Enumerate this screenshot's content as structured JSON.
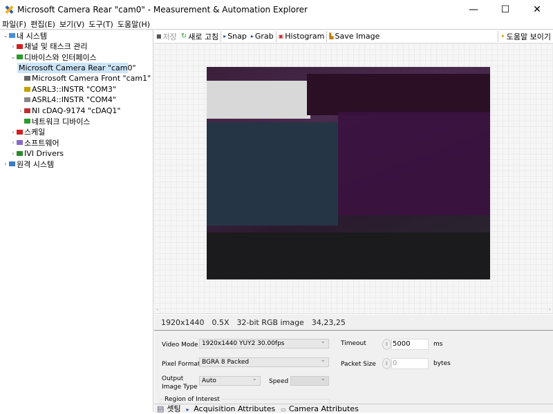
{
  "window": {
    "title": "Microsoft Camera Rear  \"cam0\" - Measurement & Automation Explorer",
    "minimize": "—",
    "maximize": "☐",
    "close": "✕"
  },
  "menu": [
    "파일(F)",
    "편집(E)",
    "보기(V)",
    "도구(T)",
    "도움말(H)"
  ],
  "tree": [
    {
      "label": "내 시스템",
      "level": 0,
      "arrow": "⌄",
      "color": "#4a8fd8"
    },
    {
      "label": "채널 및 태스크 관리",
      "level": 1,
      "arrow": "›",
      "color": "#d02020"
    },
    {
      "label": "디바이스와 인터페이스",
      "level": 1,
      "arrow": "⌄",
      "color": "#2a9a2a"
    },
    {
      "label": "Microsoft Camera Rear  \"cam0\"",
      "level": 2,
      "arrow": "",
      "color": "#666",
      "selected": true
    },
    {
      "label": "Microsoft Camera Front  \"cam1\"",
      "level": 2,
      "arrow": "",
      "color": "#666"
    },
    {
      "label": "ASRL3::INSTR \"COM3\"",
      "level": 2,
      "arrow": "",
      "color": "#c8a000"
    },
    {
      "label": "ASRL4::INSTR \"COM4\"",
      "level": 2,
      "arrow": "",
      "color": "#888"
    },
    {
      "label": "NI cDAQ-9174 \"cDAQ1\"",
      "level": 2,
      "arrow": "›",
      "color": "#c03030"
    },
    {
      "label": "네트워크 디바이스",
      "level": 2,
      "arrow": "",
      "color": "#2a9a2a"
    },
    {
      "label": "스케일",
      "level": 1,
      "arrow": "›",
      "color": "#d02020"
    },
    {
      "label": "소프트웨어",
      "level": 1,
      "arrow": "›",
      "color": "#8a6ac8"
    },
    {
      "label": "IVI Drivers",
      "level": 1,
      "arrow": "›",
      "color": "#2a8a2a"
    },
    {
      "label": "원격 시스템",
      "level": 0,
      "arrow": "›",
      "color": "#3a7ac8"
    }
  ],
  "toolbar": {
    "save": "저장",
    "refresh": "새로 고침",
    "snap": "Snap",
    "grab": "Grab",
    "histogram": "Histogram",
    "save_image": "Save Image",
    "help": "도움말 보이기"
  },
  "status": {
    "resolution": "1920x1440",
    "zoom": "0.5X",
    "type": "32-bit RGB image",
    "pixel": "34,23,25"
  },
  "settings": {
    "video_mode_label": "Video Mode",
    "video_mode": "1920x1440 YUY2 30.00fps",
    "pixel_format_label": "Pixel Format",
    "pixel_format": "BGRA 8 Packed",
    "output_type_label1": "Output",
    "output_type_label2": "Image Type",
    "output_type": "Auto",
    "speed_label": "Speed",
    "speed": "",
    "timeout_label": "Timeout",
    "timeout": "5000",
    "timeout_unit": "ms",
    "packet_label": "Packet Size",
    "packet": "0",
    "packet_unit": "bytes",
    "roi_label": "Region of Interest"
  },
  "tabs": [
    "셋팅",
    "Acquisition Attributes",
    "Camera Attributes"
  ]
}
